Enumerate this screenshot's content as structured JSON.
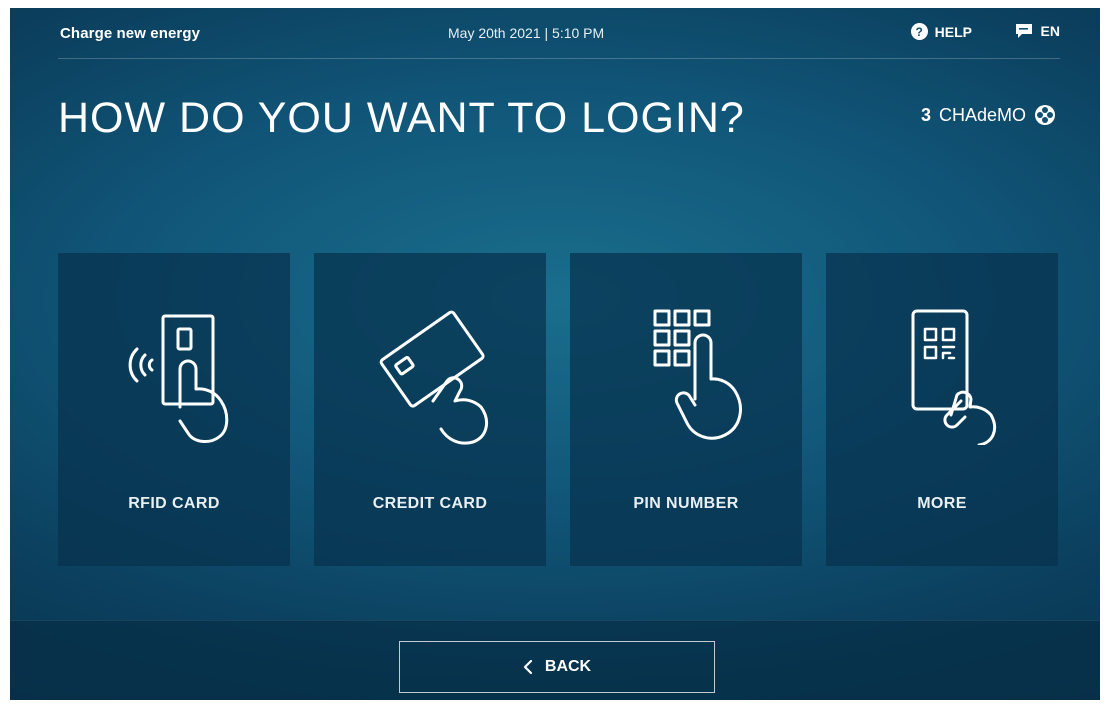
{
  "header": {
    "brand": "Charge new energy",
    "datetime": "May 20th 2021 | 5:10 PM",
    "help_label": "HELP",
    "help_icon": "question-circle-icon",
    "language_label": "EN",
    "language_icon": "chat-bubble-icon"
  },
  "page": {
    "title": "HOW DO YOU WANT TO LOGIN?",
    "connector_number": "3",
    "connector_name": "CHAdeMO",
    "connector_icon": "chademo-plug-icon"
  },
  "options": [
    {
      "label": "RFID CARD",
      "icon": "rfid-card-icon"
    },
    {
      "label": "CREDIT CARD",
      "icon": "credit-card-icon"
    },
    {
      "label": "PIN NUMBER",
      "icon": "pin-keypad-icon"
    },
    {
      "label": "MORE",
      "icon": "qr-phone-icon"
    }
  ],
  "footer": {
    "back_label": "BACK",
    "back_icon": "chevron-left-icon"
  },
  "colors": {
    "background": "#11577a",
    "card": "#07324e",
    "text": "#ffffff"
  }
}
